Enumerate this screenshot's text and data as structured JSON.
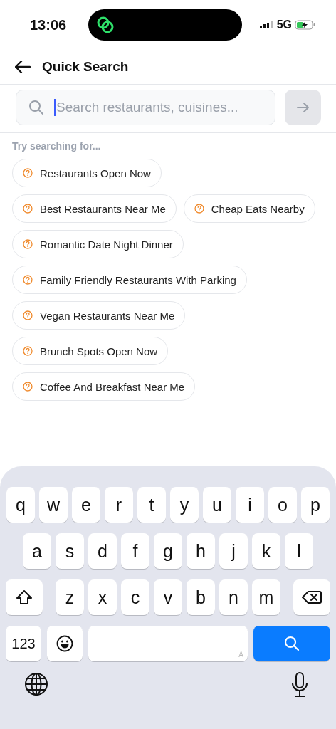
{
  "status_bar": {
    "time": "13:06",
    "network": "5G"
  },
  "header": {
    "title": "Quick Search"
  },
  "search": {
    "placeholder": "Search restaurants, cuisines..."
  },
  "suggestions_heading": "Try searching for...",
  "suggestions": [
    {
      "label": "Restaurants Open Now"
    },
    {
      "label": "Best Restaurants Near Me"
    },
    {
      "label": "Cheap Eats Nearby"
    },
    {
      "label": "Romantic Date Night Dinner"
    },
    {
      "label": "Family Friendly Restaurants With Parking"
    },
    {
      "label": "Vegan Restaurants Near Me"
    },
    {
      "label": "Brunch Spots Open Now"
    },
    {
      "label": "Coffee And Breakfast Near Me"
    }
  ],
  "keyboard": {
    "rows": [
      [
        "q",
        "w",
        "e",
        "r",
        "t",
        "y",
        "u",
        "i",
        "o",
        "p"
      ],
      [
        "a",
        "s",
        "d",
        "f",
        "g",
        "h",
        "j",
        "k",
        "l"
      ],
      [
        "z",
        "x",
        "c",
        "v",
        "b",
        "n",
        "m"
      ]
    ],
    "numbers_key": "123",
    "space_hint": "A"
  }
}
